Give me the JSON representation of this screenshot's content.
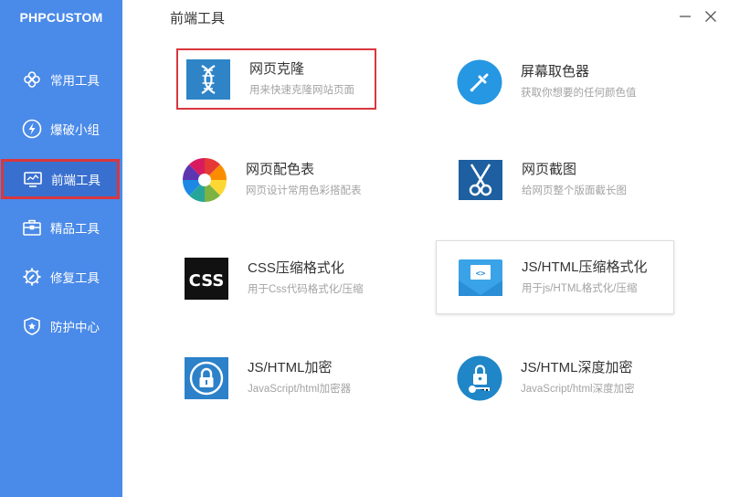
{
  "brand": "PHPCUSTOM",
  "window": {
    "title": "前端工具"
  },
  "icons": {
    "minimize": "minimize-icon",
    "close": "close-icon"
  },
  "colors": {
    "sidebar": "#4a8ae8",
    "sidebar_active": "#3970cf",
    "highlight": "#d9373d"
  },
  "sidebar": {
    "items": [
      {
        "label": "常用工具",
        "icon": "clover-icon"
      },
      {
        "label": "爆破小组",
        "icon": "lightning-icon"
      },
      {
        "label": "前端工具",
        "icon": "monitor-icon",
        "active": true
      },
      {
        "label": "精品工具",
        "icon": "toolbox-icon"
      },
      {
        "label": "修复工具",
        "icon": "gear-wrench-icon"
      },
      {
        "label": "防护中心",
        "icon": "shield-star-icon"
      }
    ]
  },
  "tools": [
    {
      "name": "网页克隆",
      "desc": "用来快速克隆网站页面",
      "icon": "dna-icon"
    },
    {
      "name": "屏幕取色器",
      "desc": "获取你想要的任何颜色值",
      "icon": "eyedropper-icon"
    },
    {
      "name": "网页配色表",
      "desc": "网页设计常用色彩搭配表",
      "icon": "color-wheel-icon"
    },
    {
      "name": "网页截图",
      "desc": "给网页整个版面截长图",
      "icon": "scissors-icon"
    },
    {
      "name": "CSS压缩格式化",
      "desc": "用于Css代码格式化/压缩",
      "icon": "css-icon",
      "icon_text": "CSS"
    },
    {
      "name": "JS/HTML压缩格式化",
      "desc": "用于js/HTML格式化/压缩",
      "icon": "code-envelope-icon",
      "icon_text": "<>"
    },
    {
      "name": "JS/HTML加密",
      "desc": "JavaScript/html加密器",
      "icon": "lock-icon"
    },
    {
      "name": "JS/HTML深度加密",
      "desc": "JavaScript/html深度加密",
      "icon": "lock-key-icon"
    }
  ]
}
